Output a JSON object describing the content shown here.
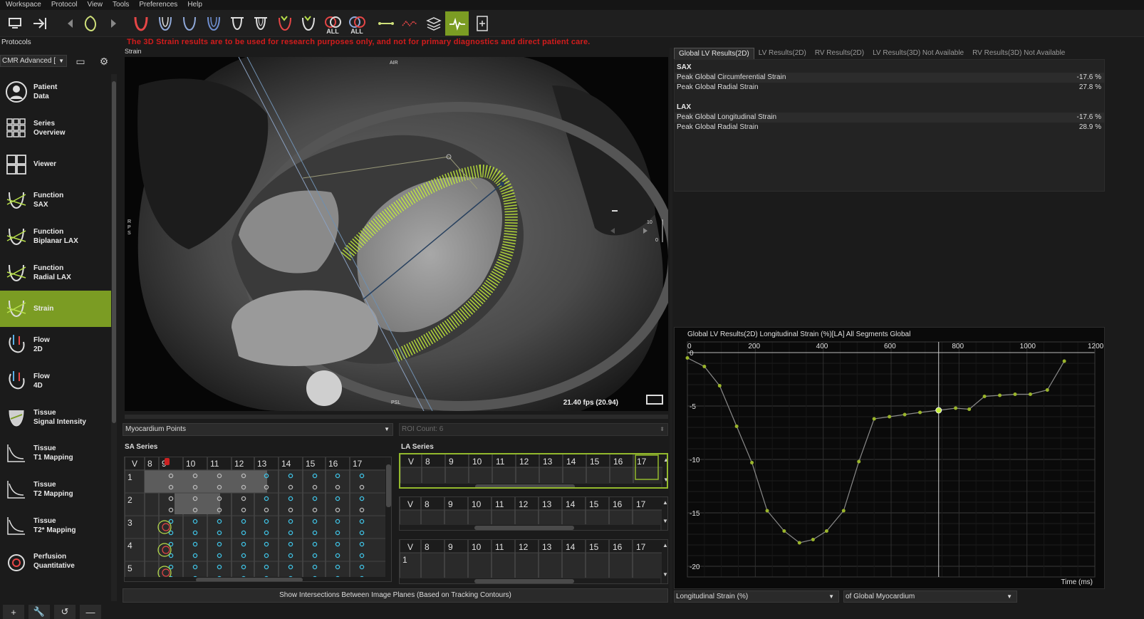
{
  "menu": [
    "Workspace",
    "Protocol",
    "View",
    "Tools",
    "Preferences",
    "Help"
  ],
  "toolbar": {
    "all_label": "ALL"
  },
  "warning": "The 3D Strain results are to be used for research purposes only, and not for primary diagnostics and direct patient care.",
  "protocols": {
    "label": "Protocols",
    "selected": "CMR Advanced [",
    "steps": [
      {
        "line1": "Patient",
        "line2": "Data",
        "icon": "patient-icon"
      },
      {
        "line1": "Series",
        "line2": "Overview",
        "icon": "series-grid-icon"
      },
      {
        "line1": "Viewer",
        "line2": "",
        "icon": "viewer-layout-icon"
      },
      {
        "line1": "Function",
        "line2": "SAX",
        "icon": "function-sax-icon"
      },
      {
        "line1": "Function",
        "line2": "Biplanar LAX",
        "icon": "function-biplanar-icon"
      },
      {
        "line1": "Function",
        "line2": "Radial LAX",
        "icon": "function-radial-icon"
      },
      {
        "line1": "Strain",
        "line2": "",
        "icon": "strain-icon",
        "active": true
      },
      {
        "line1": "Flow",
        "line2": "2D",
        "icon": "flow-2d-icon"
      },
      {
        "line1": "Flow",
        "line2": "4D",
        "icon": "flow-4d-icon"
      },
      {
        "line1": "Tissue",
        "line2": "Signal Intensity",
        "icon": "tissue-signal-icon"
      },
      {
        "line1": "Tissue",
        "line2": "T1 Mapping",
        "icon": "t1-mapping-icon"
      },
      {
        "line1": "Tissue",
        "line2": "T2 Mapping",
        "icon": "t2-mapping-icon"
      },
      {
        "line1": "Tissue",
        "line2": "T2* Mapping",
        "icon": "t2star-mapping-icon"
      },
      {
        "line1": "Perfusion",
        "line2": "Quantitative",
        "icon": "perfusion-icon"
      }
    ]
  },
  "viewer": {
    "title": "Strain",
    "orient_top": "AIR",
    "orient_left": "R\nP\nS",
    "orient_bottom": "PSL",
    "scale_top": "10",
    "scale_bottom": "0",
    "fps": "21.40 fps (20.94)"
  },
  "controls": {
    "display_select": "Myocardium Points",
    "roi_count": "ROI Count: 6",
    "sa_label": "SA Series",
    "la_label": "LA Series",
    "sa_headers": [
      "V",
      "8",
      "9",
      "10",
      "11",
      "12",
      "13",
      "14",
      "15",
      "16",
      "17"
    ],
    "la_headers": [
      "V",
      "8",
      "9",
      "10",
      "11",
      "12",
      "13",
      "14",
      "15",
      "16",
      "17"
    ],
    "sa_rows": [
      "1",
      "2",
      "3",
      "4",
      "5"
    ],
    "la_row": "1",
    "show_intersections": "Show Intersections Between Image Planes (Based on Tracking Contours)"
  },
  "results": {
    "tabs": [
      "Global LV Results(2D)",
      "LV Results(2D)",
      "RV Results(2D)",
      "LV Results(3D) Not Available",
      "RV Results(3D) Not Available"
    ],
    "sax_header": "SAX",
    "sax_rows": [
      {
        "label": "Peak Global Circumferential Strain",
        "value": "-17.6 %"
      },
      {
        "label": "Peak Global Radial Strain",
        "value": "27.8 %"
      }
    ],
    "lax_header": "LAX",
    "lax_rows": [
      {
        "label": "Peak Global Longitudinal Strain",
        "value": "-17.6 %"
      },
      {
        "label": "Peak Global Radial Strain",
        "value": "28.9 %"
      }
    ]
  },
  "chart_data": {
    "type": "line",
    "title": "Global LV Results(2D) Longitudinal Strain (%)[LA] All Segments Global",
    "xlabel": "Time (ms)",
    "ylabel": "",
    "xlim": [
      0,
      1200
    ],
    "ylim": [
      -21,
      1
    ],
    "xticks": [
      0,
      200,
      400,
      600,
      800,
      1000,
      1200
    ],
    "yticks": [
      0,
      -5,
      -10,
      -15,
      -20
    ],
    "cursor_x": 740,
    "series": [
      {
        "x": [
          0,
          50,
          95,
          145,
          190,
          235,
          285,
          330,
          370,
          410,
          460,
          505,
          550,
          595,
          640,
          685,
          740,
          790,
          830,
          875,
          920,
          965,
          1010,
          1060,
          1110
        ],
        "y": [
          -0.5,
          -1.3,
          -3.1,
          -6.9,
          -10.3,
          -14.8,
          -16.7,
          -17.8,
          -17.5,
          -16.7,
          -14.8,
          -10.2,
          -6.2,
          -6.0,
          -5.8,
          -5.6,
          -5.4,
          -5.2,
          -5.3,
          -4.1,
          -4.0,
          -3.9,
          -3.9,
          -3.5,
          -0.8
        ]
      }
    ],
    "grid": true,
    "line_color": "#8a8a8a",
    "marker_color": "#9ab52a"
  },
  "bottom_selects": {
    "measure": "Longitudinal Strain (%)",
    "scope": "of Global Myocardium"
  },
  "colors": {
    "accent": "#7b9c23",
    "warning": "#d21c1c",
    "tracking": "#c6f03a",
    "cyan_dot": "#3fc3e6"
  }
}
